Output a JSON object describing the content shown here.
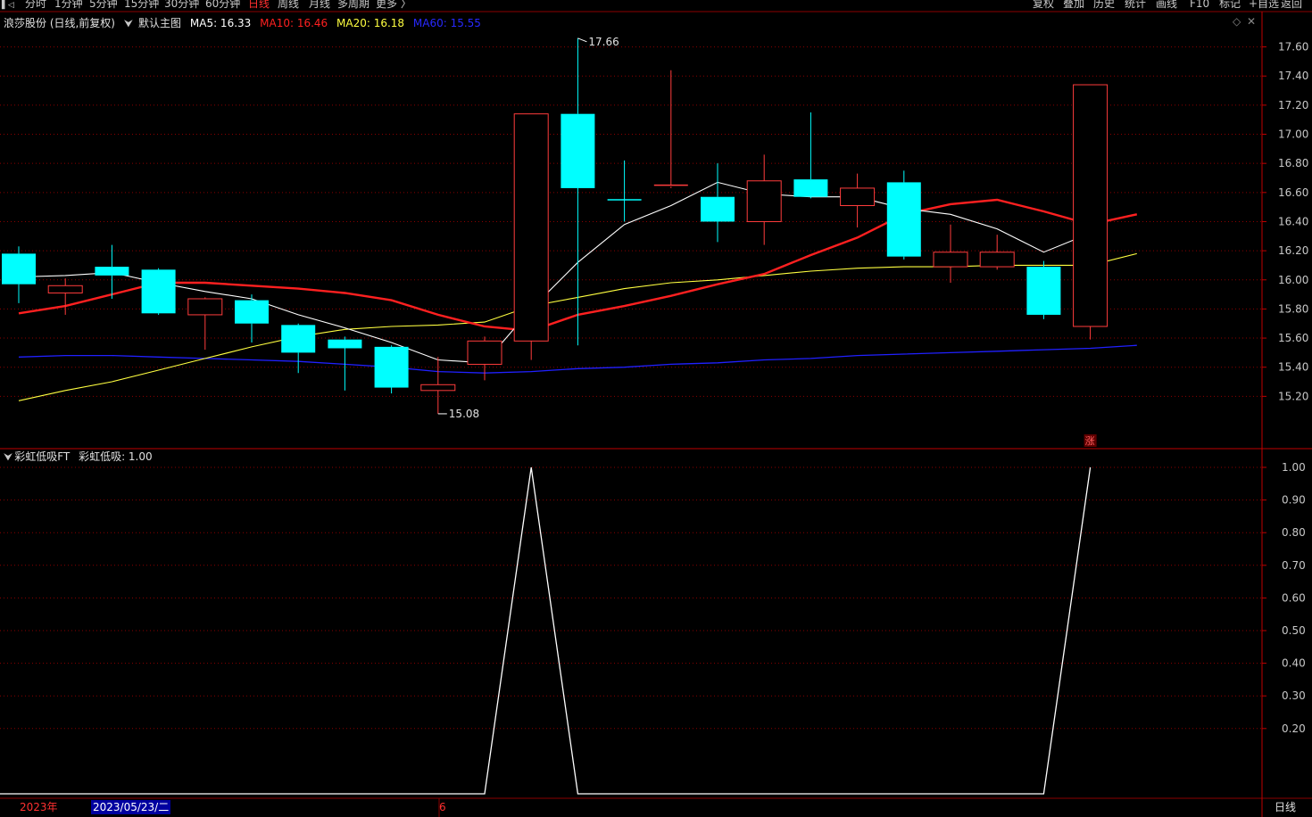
{
  "toolbar": {
    "left_icon": "collapse-icon",
    "tabs": [
      {
        "label": "分时",
        "active": false
      },
      {
        "label": "1分钟",
        "active": false
      },
      {
        "label": "5分钟",
        "active": false
      },
      {
        "label": "15分钟",
        "active": false
      },
      {
        "label": "30分钟",
        "active": false
      },
      {
        "label": "60分钟",
        "active": false
      },
      {
        "label": "日线",
        "active": true
      },
      {
        "label": "周线",
        "active": false
      },
      {
        "label": "月线",
        "active": false
      },
      {
        "label": "多周期",
        "active": false
      },
      {
        "label": "更多 〉",
        "active": false
      }
    ],
    "right": [
      "复权",
      "叠加",
      "历史",
      "统计",
      "画线",
      "F10",
      "标记",
      "+自选",
      "返回"
    ]
  },
  "main_legend": {
    "stock": "浪莎股份 (日线,前复权)",
    "template": "默认主图",
    "ma5": "MA5: 16.33",
    "ma10": "MA10: 16.46",
    "ma20": "MA20: 16.18",
    "ma60": "MA60: 15.55"
  },
  "indicator_legend": {
    "name": "彩虹低吸FT",
    "value": "彩虹低吸: 1.00"
  },
  "bottom": {
    "year": "2023年",
    "cursor_date": "2023/05/23/二",
    "month_mark": "6",
    "period": "日线"
  },
  "annotations": {
    "high": "17.66",
    "low": "15.08",
    "limit_up": "涨"
  },
  "colors": {
    "up": "#ff3c3c",
    "down": "#00ffff",
    "ma5": "#ffffff",
    "ma10": "#ff2020",
    "ma20": "#ffff40",
    "ma60": "#2020ff",
    "grid": "#8b0000",
    "indicator": "#ffffff"
  },
  "chart_data": [
    {
      "type": "candlestick",
      "title": "",
      "ylim": [
        15.0,
        17.72
      ],
      "yticks": [
        15.2,
        15.4,
        15.6,
        15.8,
        16.0,
        16.2,
        16.4,
        16.6,
        16.8,
        17.0,
        17.2,
        17.4,
        17.6
      ],
      "grid": true,
      "candles": [
        {
          "o": 16.18,
          "h": 16.23,
          "l": 15.84,
          "c": 15.97
        },
        {
          "o": 15.91,
          "h": 16.01,
          "l": 15.76,
          "c": 15.96
        },
        {
          "o": 16.09,
          "h": 16.24,
          "l": 15.87,
          "c": 16.03
        },
        {
          "o": 16.07,
          "h": 16.08,
          "l": 15.76,
          "c": 15.77
        },
        {
          "o": 15.76,
          "h": 15.88,
          "l": 15.52,
          "c": 15.87
        },
        {
          "o": 15.86,
          "h": 15.9,
          "l": 15.57,
          "c": 15.7
        },
        {
          "o": 15.69,
          "h": 15.7,
          "l": 15.36,
          "c": 15.5
        },
        {
          "o": 15.59,
          "h": 15.61,
          "l": 15.24,
          "c": 15.53
        },
        {
          "o": 15.54,
          "h": 15.55,
          "l": 15.22,
          "c": 15.26
        },
        {
          "o": 15.24,
          "h": 15.47,
          "l": 15.08,
          "c": 15.28
        },
        {
          "o": 15.42,
          "h": 15.61,
          "l": 15.31,
          "c": 15.58
        },
        {
          "o": 15.58,
          "h": 17.14,
          "l": 15.45,
          "c": 17.14
        },
        {
          "o": 17.14,
          "h": 17.66,
          "l": 15.55,
          "c": 16.63
        },
        {
          "o": 16.55,
          "h": 16.82,
          "l": 16.4,
          "c": 16.55
        },
        {
          "o": 16.64,
          "h": 17.44,
          "l": 16.63,
          "c": 16.65
        },
        {
          "o": 16.57,
          "h": 16.8,
          "l": 16.26,
          "c": 16.4
        },
        {
          "o": 16.4,
          "h": 16.86,
          "l": 16.24,
          "c": 16.68
        },
        {
          "o": 16.69,
          "h": 17.15,
          "l": 16.56,
          "c": 16.57
        },
        {
          "o": 16.51,
          "h": 16.73,
          "l": 16.36,
          "c": 16.63
        },
        {
          "o": 16.67,
          "h": 16.75,
          "l": 16.14,
          "c": 16.16
        },
        {
          "o": 16.09,
          "h": 16.38,
          "l": 15.98,
          "c": 16.19
        },
        {
          "o": 16.09,
          "h": 16.31,
          "l": 16.07,
          "c": 16.19
        },
        {
          "o": 16.09,
          "h": 16.13,
          "l": 15.73,
          "c": 15.76
        },
        {
          "o": 15.68,
          "h": 17.34,
          "l": 15.59,
          "c": 17.34
        }
      ],
      "ma5": [
        16.02,
        16.03,
        16.05,
        15.98,
        15.92,
        15.87,
        15.76,
        15.67,
        15.57,
        15.45,
        15.43,
        15.8,
        16.12,
        16.38,
        16.51,
        16.67,
        16.59,
        16.57,
        16.57,
        16.49,
        16.45,
        16.35,
        16.19,
        16.32
      ],
      "ma10": [
        15.77,
        15.82,
        15.9,
        15.98,
        15.98,
        15.96,
        15.94,
        15.91,
        15.86,
        15.76,
        15.68,
        15.65,
        15.76,
        15.82,
        15.89,
        15.97,
        16.04,
        16.17,
        16.29,
        16.45,
        16.52,
        16.55,
        16.47,
        16.38,
        16.45
      ],
      "ma20": [
        15.17,
        15.24,
        15.3,
        15.38,
        15.46,
        15.54,
        15.61,
        15.66,
        15.68,
        15.69,
        15.71,
        15.82,
        15.88,
        15.94,
        15.98,
        16.0,
        16.03,
        16.06,
        16.08,
        16.09,
        16.09,
        16.1,
        16.1,
        16.1,
        16.18
      ],
      "ma60": [
        15.47,
        15.48,
        15.48,
        15.47,
        15.46,
        15.45,
        15.44,
        15.42,
        15.4,
        15.37,
        15.36,
        15.37,
        15.39,
        15.4,
        15.42,
        15.43,
        15.45,
        15.46,
        15.48,
        15.49,
        15.5,
        15.51,
        15.52,
        15.53,
        15.55
      ]
    },
    {
      "type": "line",
      "title": "",
      "ylim": [
        -0.0,
        1.0
      ],
      "yticks": [
        0.2,
        0.3,
        0.4,
        0.5,
        0.6,
        0.7,
        0.8,
        0.9,
        1.0
      ],
      "grid": true,
      "series": [
        {
          "name": "彩虹低吸",
          "values": [
            0,
            0,
            0,
            0,
            0,
            0,
            0,
            0,
            0,
            0,
            0,
            1,
            0,
            0,
            0,
            0,
            0,
            0,
            0,
            0,
            0,
            0,
            0,
            1
          ]
        }
      ]
    }
  ]
}
